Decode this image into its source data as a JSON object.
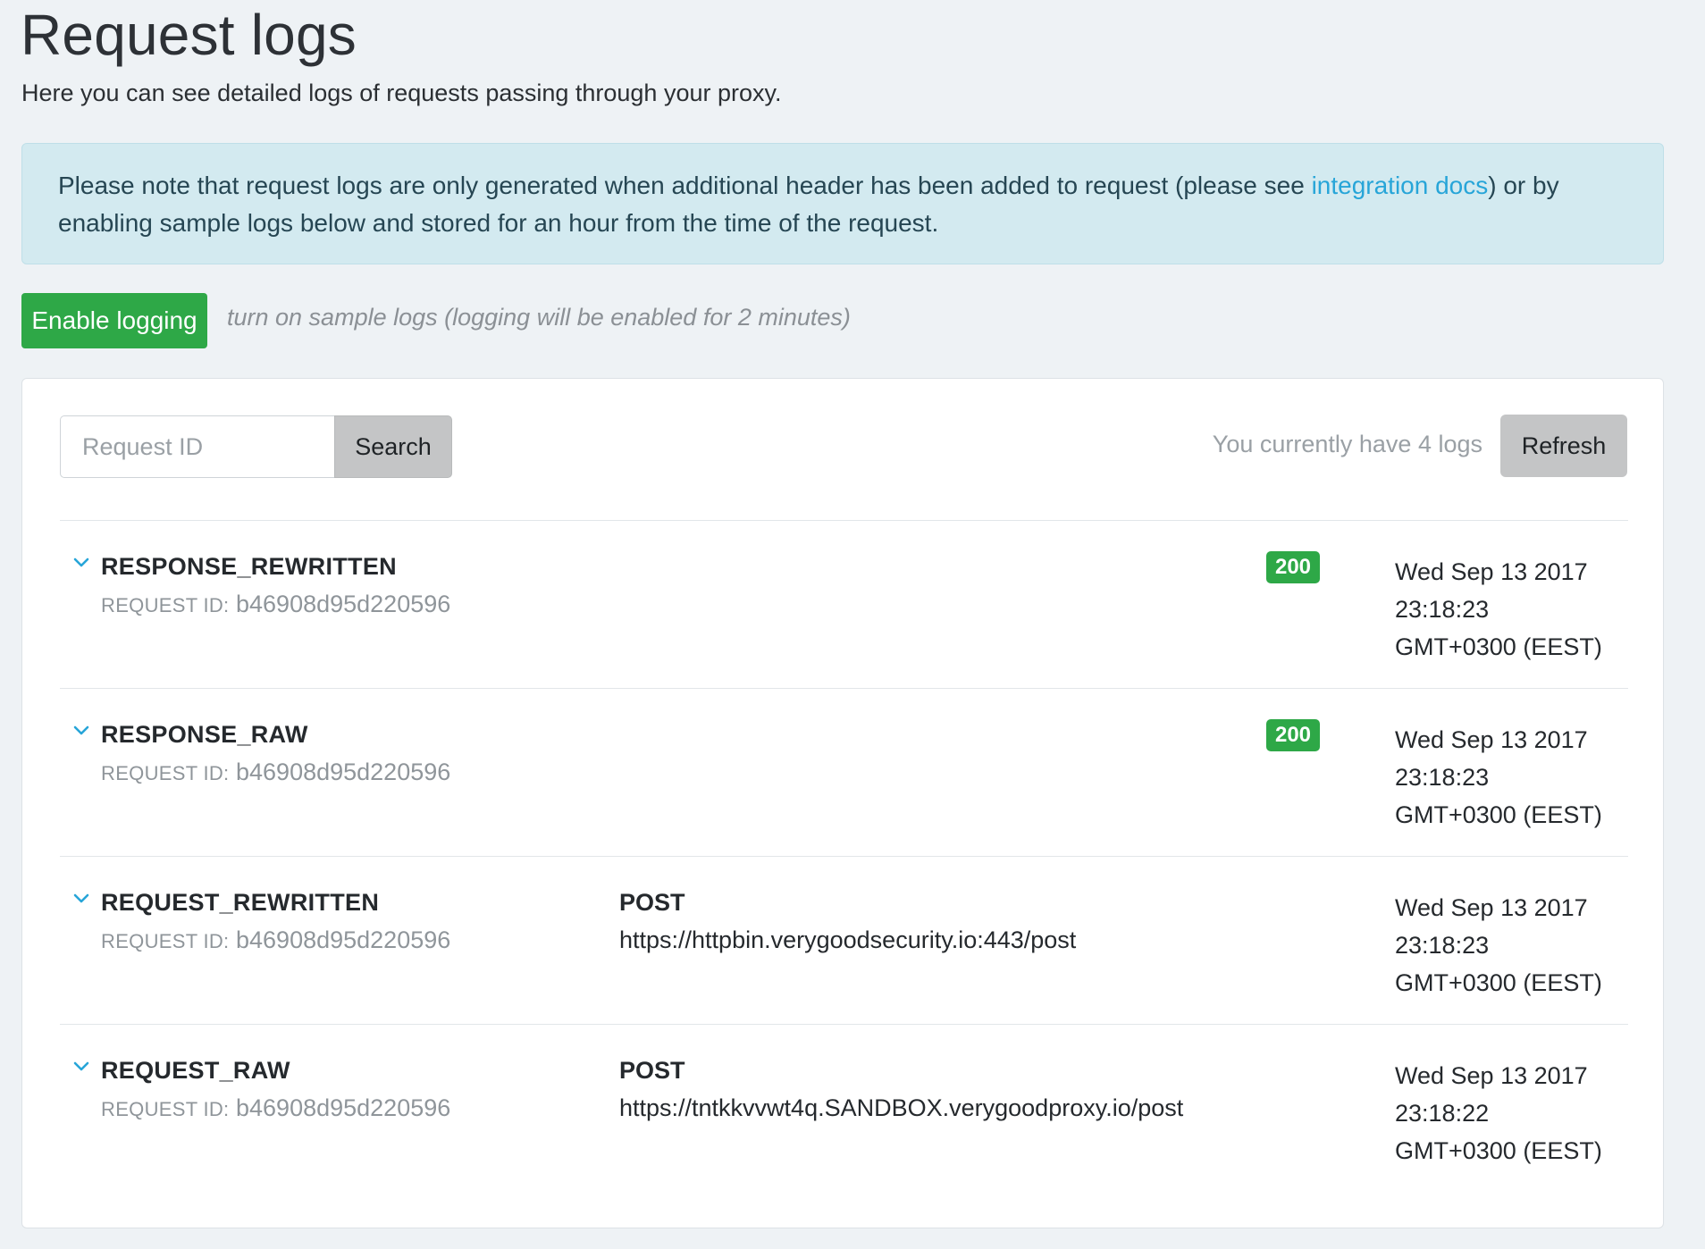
{
  "header": {
    "title": "Request logs",
    "subtitle": "Here you can see detailed logs of requests passing through your proxy."
  },
  "notice": {
    "text_before": "Please note that request logs are only generated when additional header has been added to request (please see ",
    "link_text": "integration docs",
    "text_after": ") or by enabling sample logs below and stored for an hour from the time of the request."
  },
  "logging": {
    "button_label": "Enable logging",
    "hint": "turn on sample logs (logging will be enabled for 2 minutes)"
  },
  "toolbar": {
    "search_placeholder": "Request ID",
    "search_value": "",
    "search_label": "Search",
    "count_text": "You currently have 4 logs",
    "refresh_label": "Refresh"
  },
  "colors": {
    "success": "#2ea847",
    "link": "#27a5d8",
    "notice_bg": "#d3eaf0"
  },
  "logs": [
    {
      "type": "RESPONSE_REWRITTEN",
      "request_id_label": "REQUEST ID:",
      "request_id": "b46908d95d220596",
      "method": "",
      "url": "",
      "status": "200",
      "timestamp": [
        "Wed Sep 13 2017",
        "23:18:23",
        "GMT+0300 (EEST)"
      ]
    },
    {
      "type": "RESPONSE_RAW",
      "request_id_label": "REQUEST ID:",
      "request_id": "b46908d95d220596",
      "method": "",
      "url": "",
      "status": "200",
      "timestamp": [
        "Wed Sep 13 2017",
        "23:18:23",
        "GMT+0300 (EEST)"
      ]
    },
    {
      "type": "REQUEST_REWRITTEN",
      "request_id_label": "REQUEST ID:",
      "request_id": "b46908d95d220596",
      "method": "POST",
      "url": "https://httpbin.verygoodsecurity.io:443/post",
      "status": "",
      "timestamp": [
        "Wed Sep 13 2017",
        "23:18:23",
        "GMT+0300 (EEST)"
      ]
    },
    {
      "type": "REQUEST_RAW",
      "request_id_label": "REQUEST ID:",
      "request_id": "b46908d95d220596",
      "method": "POST",
      "url": "https://tntkkvvwt4q.SANDBOX.verygoodproxy.io/post",
      "status": "",
      "timestamp": [
        "Wed Sep 13 2017",
        "23:18:22",
        "GMT+0300 (EEST)"
      ]
    }
  ]
}
